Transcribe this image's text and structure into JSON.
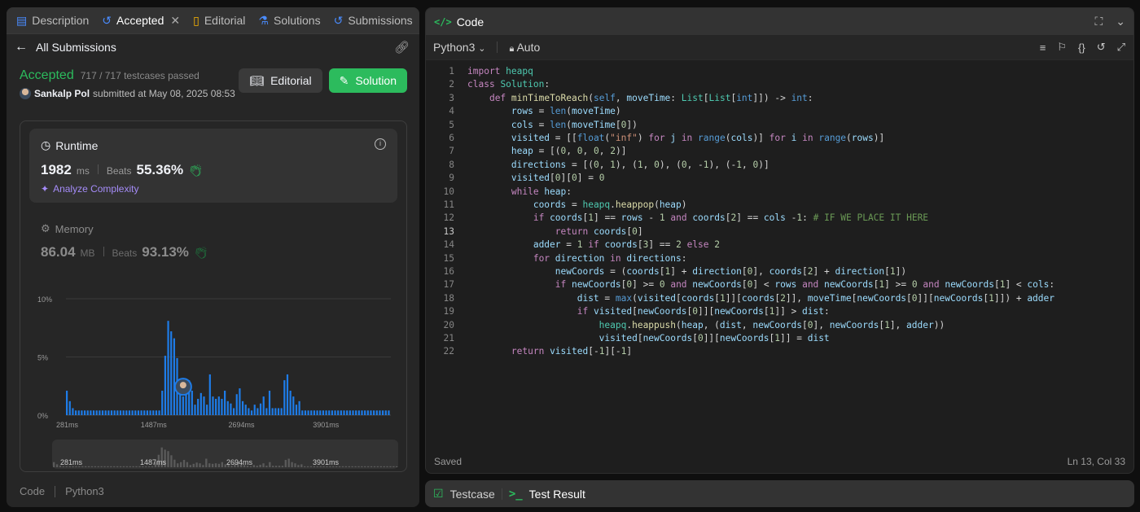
{
  "left": {
    "tabs": [
      {
        "label": "Description",
        "icon": "description-icon"
      },
      {
        "label": "Accepted",
        "icon": "history-icon"
      },
      {
        "label": "Editorial",
        "icon": "book-icon"
      },
      {
        "label": "Solutions",
        "icon": "flask-icon"
      },
      {
        "label": "Submissions",
        "icon": "history-icon"
      }
    ],
    "back_label": "All Submissions",
    "status": "Accepted",
    "testcases": "717 / 717 testcases passed",
    "submitter_name": "Sankalp Pol",
    "submitted_text": "submitted at May 08, 2025 08:53",
    "editorial_button": "Editorial",
    "solution_button": "Solution",
    "runtime": {
      "title": "Runtime",
      "value": "1982",
      "unit": "ms",
      "beats_label": "Beats",
      "beats": "55.36%",
      "analyze": "Analyze Complexity"
    },
    "memory": {
      "title": "Memory",
      "value": "86.04",
      "unit": "MB",
      "beats_label": "Beats",
      "beats": "93.13%"
    },
    "code_label": "Code",
    "lang_label": "Python3"
  },
  "chart_data": {
    "type": "bar",
    "ylim": [
      0,
      10
    ],
    "ytick_labels": [
      "0%",
      "5%",
      "10%"
    ],
    "xtick_labels": [
      "281ms",
      "1487ms",
      "2694ms",
      "3901ms"
    ],
    "values": [
      2.1,
      1.2,
      0.6,
      0.4,
      0.4,
      0.4,
      0.4,
      0.4,
      0.4,
      0.4,
      0.4,
      0.4,
      0.4,
      0.4,
      0.4,
      0.4,
      0.4,
      0.4,
      0.4,
      0.4,
      0.4,
      0.4,
      0.4,
      0.4,
      0.4,
      0.4,
      0.4,
      0.4,
      0.4,
      0.4,
      0.4,
      0.4,
      2.1,
      5.1,
      8.1,
      7.2,
      6.6,
      4.9,
      3.1,
      1.6,
      2.1,
      3.0,
      2.1,
      0.9,
      1.4,
      1.9,
      1.6,
      0.9,
      3.5,
      1.6,
      1.4,
      1.6,
      1.4,
      2.1,
      1.2,
      1.0,
      0.6,
      1.8,
      2.3,
      1.2,
      0.9,
      0.6,
      0.4,
      0.9,
      0.6,
      1.0,
      1.6,
      0.6,
      2.1,
      0.6,
      0.6,
      0.6,
      0.6,
      3.0,
      3.5,
      2.1,
      1.6,
      0.9,
      1.2,
      0.4,
      0.4,
      0.4,
      0.4,
      0.4,
      0.4,
      0.4,
      0.4,
      0.4,
      0.4,
      0.4,
      0.4,
      0.4,
      0.4,
      0.4,
      0.4,
      0.4,
      0.4,
      0.4,
      0.4,
      0.4,
      0.4,
      0.4,
      0.4,
      0.4,
      0.4,
      0.4,
      0.4,
      0.4,
      0.4
    ],
    "highlight_index": 39,
    "bar_color": "#1e7ce8",
    "grid": true
  },
  "right": {
    "title": "Code",
    "language": "Python3",
    "mode": "Auto",
    "saved": "Saved",
    "cursor": "Ln 13, Col 33",
    "current_line": 13,
    "bottom_tabs": [
      "Testcase",
      "Test Result"
    ]
  },
  "code_lines": [
    "import heapq",
    "class Solution:",
    "    def minTimeToReach(self, moveTime: List[List[int]]) -> int:",
    "        rows = len(moveTime)",
    "        cols = len(moveTime[0])",
    "        visited = [[float(\"inf\") for j in range(cols)] for i in range(rows)]",
    "        heap = [(0, 0, 0, 2)]",
    "        directions = [(0, 1), (1, 0), (0, -1), (-1, 0)]",
    "        visited[0][0] = 0",
    "        while heap:",
    "            coords = heapq.heappop(heap)",
    "            if coords[1] == rows - 1 and coords[2] == cols -1: # IF WE PLACE IT HERE",
    "                return coords[0]",
    "            adder = 1 if coords[3] == 2 else 2",
    "            for direction in directions:",
    "                newCoords = (coords[1] + direction[0], coords[2] + direction[1])",
    "                if newCoords[0] >= 0 and newCoords[0] < rows and newCoords[1] >= 0 and newCoords[1] < cols:",
    "                    dist = max(visited[coords[1]][coords[2]], moveTime[newCoords[0]][newCoords[1]]) + adder",
    "                    if visited[newCoords[0]][newCoords[1]] > dist:",
    "                        heapq.heappush(heap, (dist, newCoords[0], newCoords[1], adder))",
    "                        visited[newCoords[0]][newCoords[1]] = dist",
    "        return visited[-1][-1]"
  ]
}
